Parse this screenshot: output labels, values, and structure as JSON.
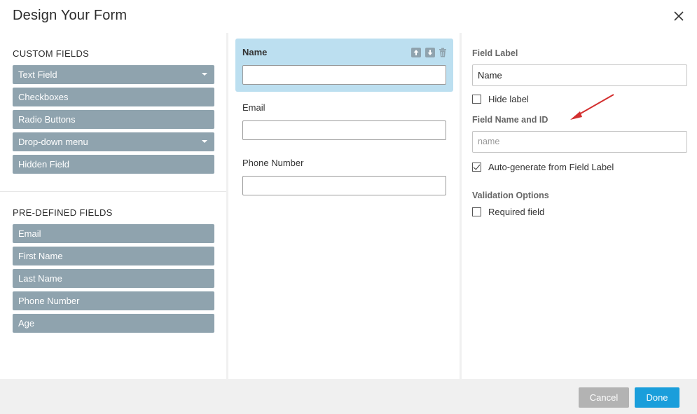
{
  "dialog": {
    "title": "Design Your Form"
  },
  "left": {
    "custom_title": "CUSTOM FIELDS",
    "custom_fields": [
      {
        "label": "Text Field",
        "has_dropdown": true
      },
      {
        "label": "Checkboxes",
        "has_dropdown": false
      },
      {
        "label": "Radio Buttons",
        "has_dropdown": false
      },
      {
        "label": "Drop-down menu",
        "has_dropdown": true
      },
      {
        "label": "Hidden Field",
        "has_dropdown": false
      }
    ],
    "predefined_title": "PRE-DEFINED FIELDS",
    "predefined_fields": [
      {
        "label": "Email"
      },
      {
        "label": "First Name"
      },
      {
        "label": "Last Name"
      },
      {
        "label": "Phone Number"
      },
      {
        "label": "Age"
      }
    ]
  },
  "form": {
    "fields": [
      {
        "label": "Name",
        "selected": true
      },
      {
        "label": "Email",
        "selected": false
      },
      {
        "label": "Phone Number",
        "selected": false
      }
    ],
    "controls": [
      "arrow-up-icon",
      "arrow-down-icon",
      "trash-icon"
    ]
  },
  "settings": {
    "field_label_title": "Field Label",
    "field_label_value": "Name",
    "hide_label": {
      "label": "Hide label",
      "checked": false
    },
    "name_id_title": "Field Name and ID",
    "name_id_placeholder": "name",
    "auto_generate": {
      "label": "Auto-generate from Field Label",
      "checked": true
    },
    "validation_title": "Validation Options",
    "required": {
      "label": "Required field",
      "checked": false
    }
  },
  "footer": {
    "cancel_label": "Cancel",
    "done_label": "Done"
  },
  "colors": {
    "field_button": "#8fa3ae",
    "selected_field": "#bcdff0",
    "done_button": "#1a9edb",
    "cancel_button": "#b3b3b3",
    "annotation_arrow": "#d32f2f"
  }
}
